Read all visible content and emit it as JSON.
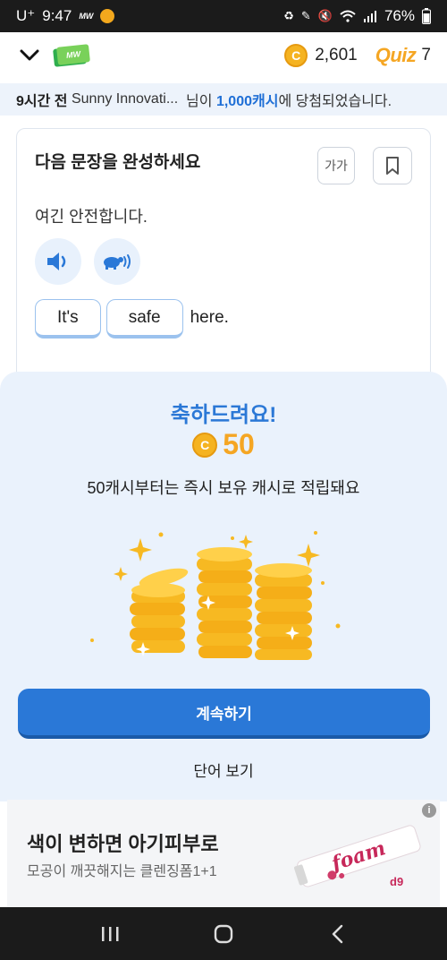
{
  "status_bar": {
    "carrier": "U⁺",
    "time": "9:47",
    "app_mini": "MW",
    "battery": "76%"
  },
  "header": {
    "logo_text": "MW",
    "coin_symbol": "C",
    "coins": "2,601",
    "quiz_label": "Quiz",
    "quiz_count": "7"
  },
  "banner": {
    "time_ago": "9시간 전",
    "user": "Sunny Innovati...",
    "middle": "님이",
    "amount": "1,000캐시",
    "suffix": "에 당첨되었습니다."
  },
  "quiz": {
    "title": "다음 문장을 완성하세요",
    "font_size_label": "가가",
    "korean_sentence": "여긴 안전합니다.",
    "chips": [
      "It's",
      "safe"
    ],
    "trailing_word": "here."
  },
  "reward_sheet": {
    "congrats": "축하드려요!",
    "coin_symbol": "C",
    "amount": "50",
    "description": "50캐시부터는 즉시 보유 캐시로 적립돼요",
    "continue_label": "계속하기",
    "view_word_label": "단어 보기"
  },
  "ad": {
    "info": "i",
    "title": "색이 변하면 아기피부로",
    "subtitle": "모공이 깨끗해지는 클렌징폼1+1",
    "product_text": "foam",
    "brand": "d9"
  },
  "colors": {
    "accent_blue": "#2a78d7",
    "coin_gold": "#f5b321",
    "sheet_bg": "#eaf2fc",
    "quiz_orange": "#f5a623"
  }
}
